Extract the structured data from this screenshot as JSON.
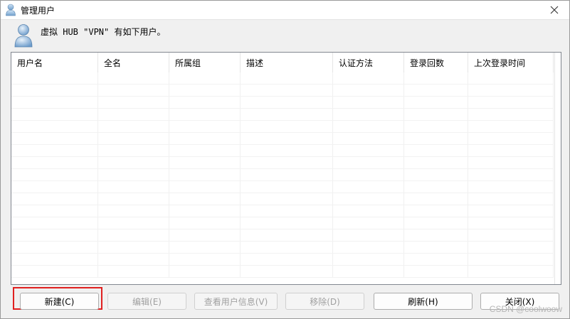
{
  "window": {
    "title": "管理用户",
    "header_text": "虚拟 HUB \"VPN\" 有如下用户。"
  },
  "table": {
    "columns": [
      "用户名",
      "全名",
      "所属组",
      "描述",
      "认证方法",
      "登录回数",
      "上次登录时间"
    ],
    "rows": []
  },
  "buttons": {
    "new": "新建(C)",
    "edit": "编辑(E)",
    "view_info": "查看用户信息(V)",
    "remove": "移除(D)",
    "refresh": "刷新(H)",
    "close": "关闭(X)"
  },
  "watermark": "CSDN @coolwoow",
  "colors": {
    "highlight": "#e02020"
  },
  "icons": [
    "user-icon",
    "close-icon"
  ]
}
